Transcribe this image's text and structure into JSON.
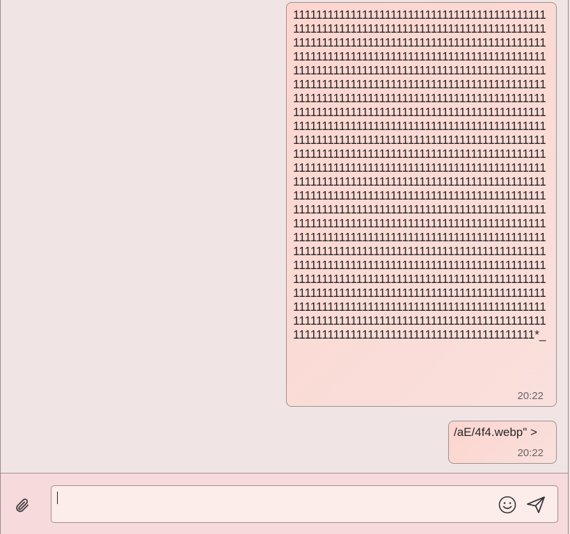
{
  "messages": [
    {
      "text": "1111111111111111111111111111111111111111111111111111111111111111111111111111111111111111111111111111111111111111111111111111111111111111111111111111111111111111111111111111111111111111111111111111111111111111111111111111111111111111111111111111111111111111111111111111111111111111111111111111111111111111111111111111111111111111111111111111111111111111111111111111111111111111111111111111111111111111111111111111111111111111111111111111111111111111111111111111111111111111111111111111111111111111111111111111111111111111111111111111111111111111111111111111111111111111111111111111111111111111111111111111111111111111111111111111111111111111111111111111111111111111111111111111111111111111111111111111111111111111111111111111111111111111111111111111111111111111111111111111111111111111111111111111111111111111111111111111111111111111111111111111111111111111111111111111111111111111111111111111111111111111111111111111111111111111111111111111111111111111111111111111111111111111111111111111111111111111111111111111111111111111111111111111111111111111111111*_",
      "time": "20:22"
    },
    {
      "text": "/aE/4f4.webp\" >",
      "time": "20:22"
    }
  ],
  "composer": {
    "placeholder": "",
    "value": ""
  },
  "icons": {
    "attach": "paperclip-icon",
    "emoji": "smiley-icon",
    "send": "paper-plane-icon"
  },
  "colors": {
    "background": "#f1e4e4",
    "bubble": "#fdd5cf",
    "composer_bar": "#f7dadc",
    "input": "#fcecea"
  }
}
